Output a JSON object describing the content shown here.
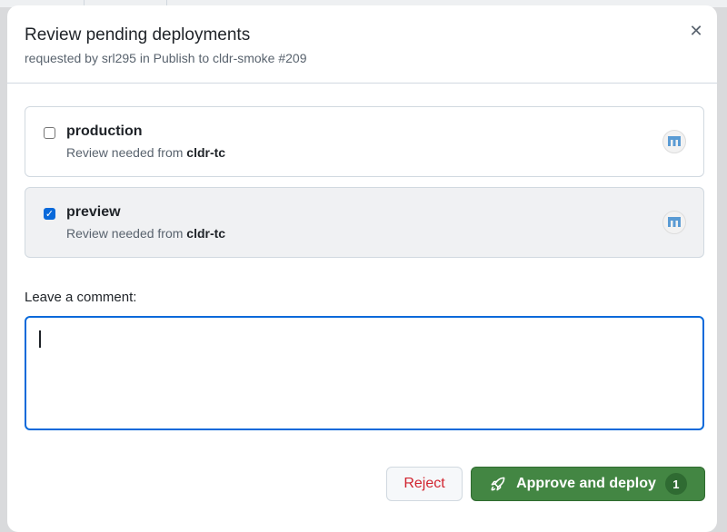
{
  "dialog": {
    "title": "Review pending deployments",
    "subtitle": "requested by srl295 in Publish to cldr-smoke #209",
    "close_icon": "close-icon"
  },
  "environments": [
    {
      "name": "production",
      "checked": false,
      "review_prefix": "Review needed from ",
      "reviewer": "cldr-tc"
    },
    {
      "name": "preview",
      "checked": true,
      "review_prefix": "Review needed from ",
      "reviewer": "cldr-tc"
    }
  ],
  "comment": {
    "label": "Leave a comment:",
    "value": ""
  },
  "actions": {
    "reject_label": "Reject",
    "approve_label": "Approve and deploy",
    "approve_count": "1",
    "approve_icon": "rocket-icon"
  },
  "colors": {
    "approve": "#438643",
    "reject_text": "#d1242f",
    "focus": "#0969da"
  }
}
